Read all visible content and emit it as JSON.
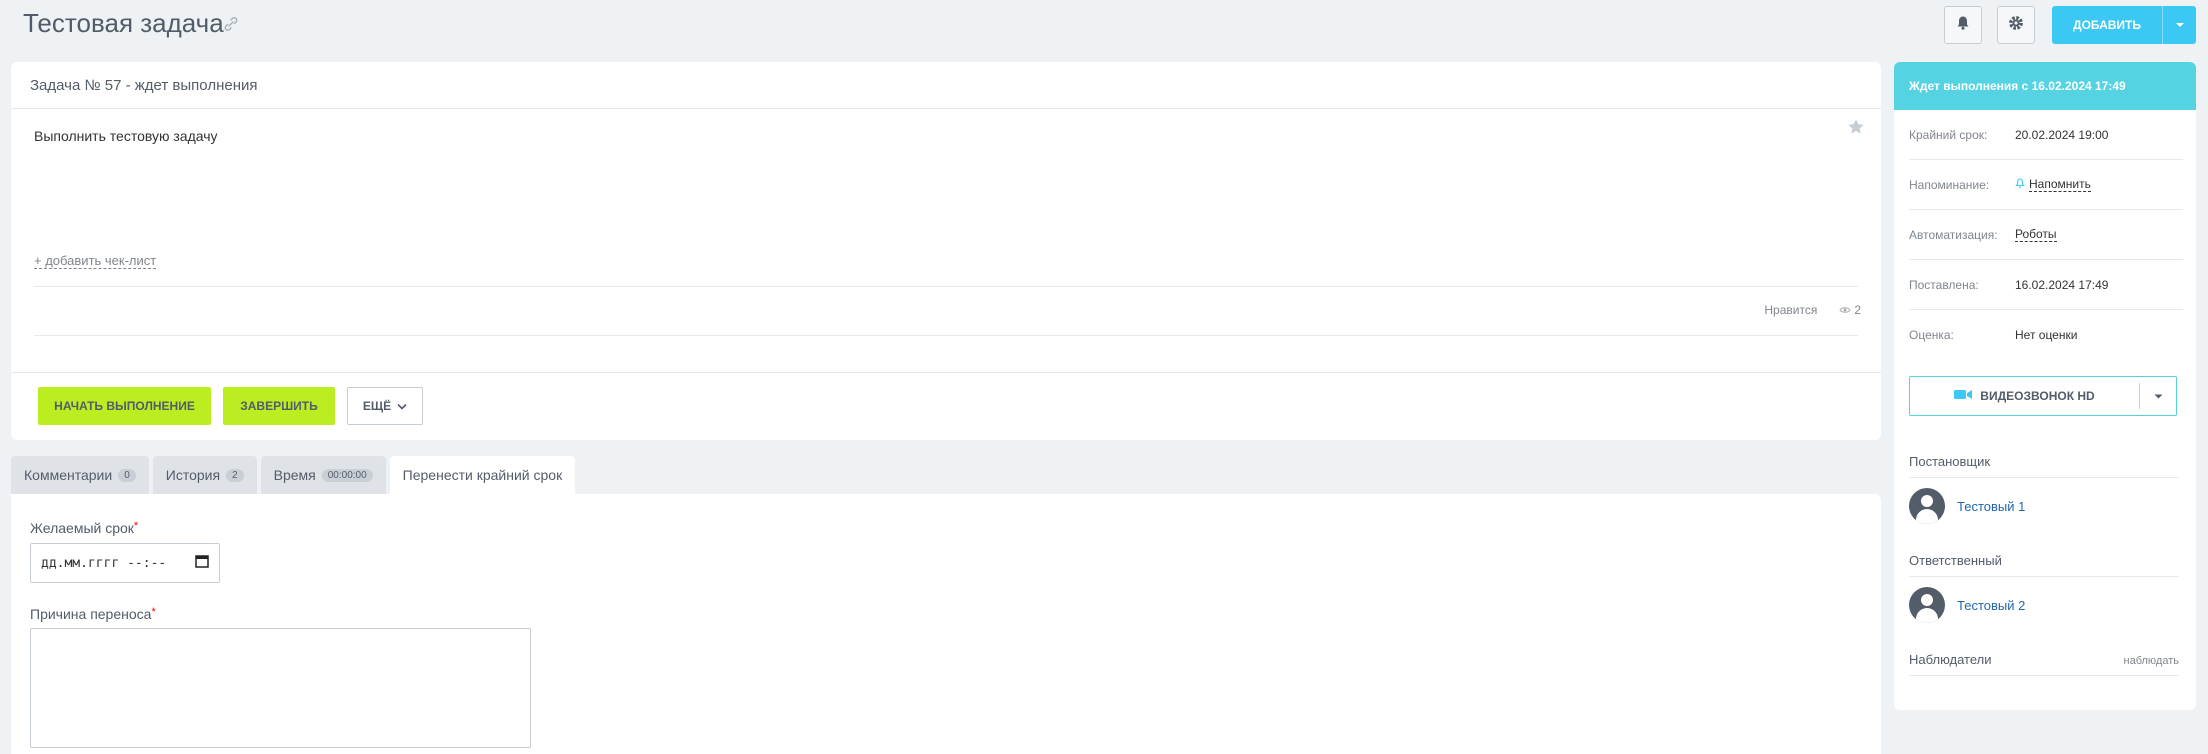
{
  "header": {
    "title": "Тестовая задача",
    "add_label": "ДОБАВИТЬ",
    "accent_color": "#3bc8f5"
  },
  "task": {
    "heading": "Задача № 57 - ждет выполнения",
    "description": "Выполнить тестовую задачу",
    "add_checklist": "+ добавить чек-лист",
    "like_label": "Нравится",
    "views_count": "2",
    "start_label": "НАЧАТЬ ВЫПОЛНЕНИЕ",
    "finish_label": "ЗАВЕРШИТЬ",
    "more_label": "ЕЩЁ"
  },
  "tabs": [
    {
      "label": "Комментарии",
      "count": "0"
    },
    {
      "label": "История",
      "count": "2"
    },
    {
      "label": "Время",
      "count": "00:00:00"
    },
    {
      "label": "Перенести крайний срок",
      "count": ""
    }
  ],
  "reschedule": {
    "date_label": "Желаемый срок",
    "date_placeholder": "дд.мм.гггг --:--",
    "reason_label": "Причина переноса",
    "required_mark": "*"
  },
  "sidebar": {
    "status": "Ждет выполнения с 16.02.2024 17:49",
    "rows": [
      {
        "key": "Крайний срок:",
        "value": "20.02.2024 19:00"
      },
      {
        "key": "Напоминание:",
        "value": "Напомнить"
      },
      {
        "key": "Автоматизация:",
        "value": "Роботы"
      },
      {
        "key": "Поставлена:",
        "value": "16.02.2024 17:49"
      },
      {
        "key": "Оценка:",
        "value": "Нет оценки"
      }
    ],
    "video_label": "ВИДЕОЗВОНОК HD",
    "creator_title": "Постановщик",
    "creator_name": "Тестовый 1",
    "responsible_title": "Ответственный",
    "responsible_name": "Тестовый 2",
    "observers_title": "Наблюдатели",
    "observe_link": "наблюдать"
  }
}
